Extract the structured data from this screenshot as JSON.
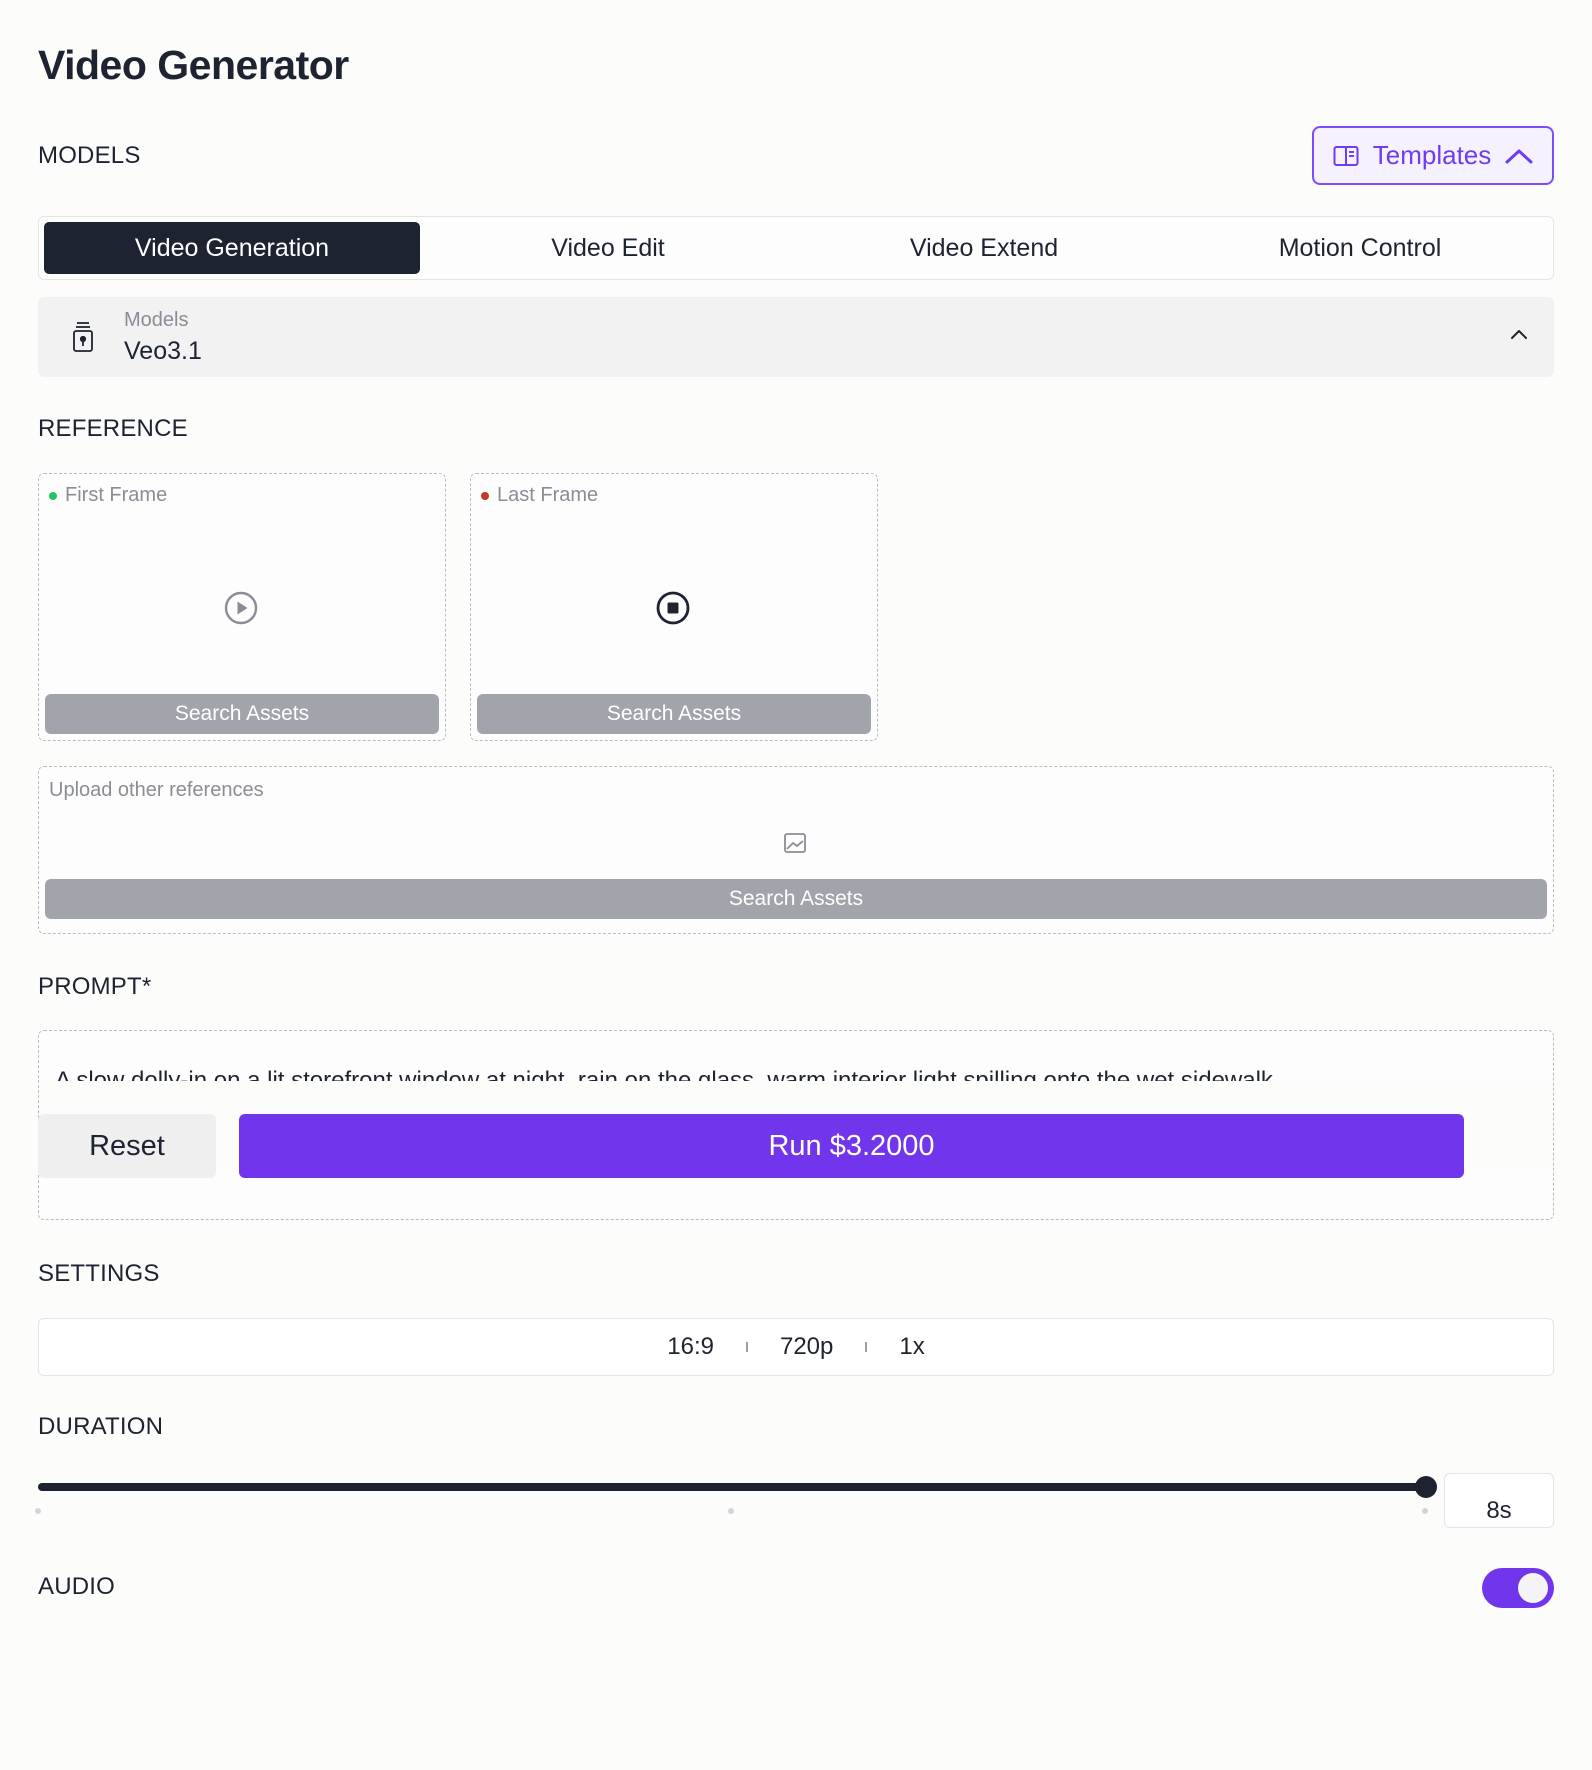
{
  "app": {
    "title": "Video Generator"
  },
  "models_section": {
    "label": "MODELS",
    "templates_button": {
      "label": "Templates",
      "icon": "book-open-icon",
      "chevron": "chevron-up-icon"
    },
    "tabs": [
      {
        "label": "Video Generation",
        "active": true
      },
      {
        "label": "Video Edit",
        "active": false
      },
      {
        "label": "Video Extend",
        "active": false
      },
      {
        "label": "Motion Control",
        "active": false
      }
    ],
    "model_select": {
      "label": "Models",
      "value": "Veo3.1",
      "icon": "model-bottle-icon",
      "chevron": "chevron-up-icon"
    }
  },
  "reference_section": {
    "label": "REFERENCE",
    "first_frame": {
      "label": "First Frame",
      "dot_color": "#22c55e",
      "icon": "play-circle-icon",
      "button": "Search Assets"
    },
    "last_frame": {
      "label": "Last Frame",
      "dot_color": "#c0392b",
      "icon": "stop-circle-icon",
      "button": "Search Assets"
    },
    "other": {
      "label": "Upload other references",
      "icon": "image-icon",
      "button": "Search Assets"
    }
  },
  "prompt_section": {
    "label": "PROMPT*",
    "text": "A slow dolly-in on a lit storefront window at night, rain on the glass, warm interior light spilling onto the wet sidewalk"
  },
  "actions": {
    "reset": "Reset",
    "run": "Run $3.2000"
  },
  "settings_section": {
    "label": "SETTINGS",
    "aspect_ratio": "16:9",
    "resolution": "720p",
    "count": "1x"
  },
  "duration_section": {
    "label": "DURATION",
    "value": "8s",
    "slider_fraction": 1.0
  },
  "audio_section": {
    "label": "AUDIO",
    "enabled": true
  },
  "colors": {
    "accent": "#7135eb",
    "dark": "#1d2330",
    "button_gray": "#a1a4aa"
  }
}
